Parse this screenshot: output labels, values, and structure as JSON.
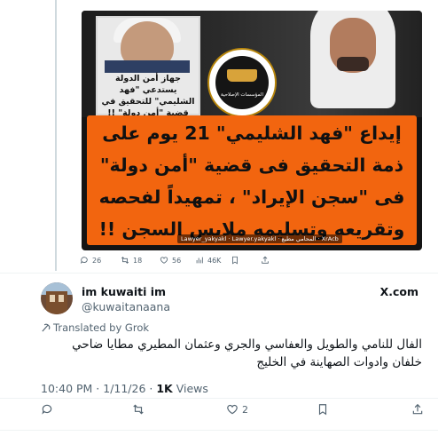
{
  "quoted_post": {
    "image": {
      "inset_caption": "جهاز أمن الدولة يستدعي \"فهد الشليمي\" للتحقيق في قضية \"أمن دولة\" !!",
      "emblem_text": "المؤسسات الإصلاحية",
      "headline": "إيداع \"فهد الشليمي\" 21 يوم على ذمة التحقيق فى قضية \"أمن دولة\" فى \"سجن الإيراد\" ، تمهيداً لفحصه وتقريعه وتسليمه ملابس السجن !!",
      "credits": "Lawyer_yakyakl · Lawyer.yakyakl · المحامي مطيع · XrAcb"
    },
    "stats": {
      "replies": "26",
      "reposts": "18",
      "likes": "56",
      "views": "46K"
    }
  },
  "post": {
    "display_name": "im kuwaiti im",
    "handle": "@kuwaitanaana",
    "via": "X.com",
    "translated_label": "Translated by Grok",
    "text": "الفال للنامي والطويل والعفاسي والجري وعثمان المطيري مطايا ضاحي خلفان وادوات الصهاينة في الخليج",
    "timestamp": "10:40 PM · 1/11/26 · ",
    "views_count": "1K",
    "views_label": " Views",
    "actions": {
      "likes": "2"
    }
  },
  "icons": [
    "reply-icon",
    "repost-icon",
    "like-icon",
    "views-icon",
    "bookmark-icon",
    "share-icon",
    "grok-icon"
  ],
  "colors": {
    "orange_banner": "#f2650f",
    "muted_text": "#536471"
  }
}
